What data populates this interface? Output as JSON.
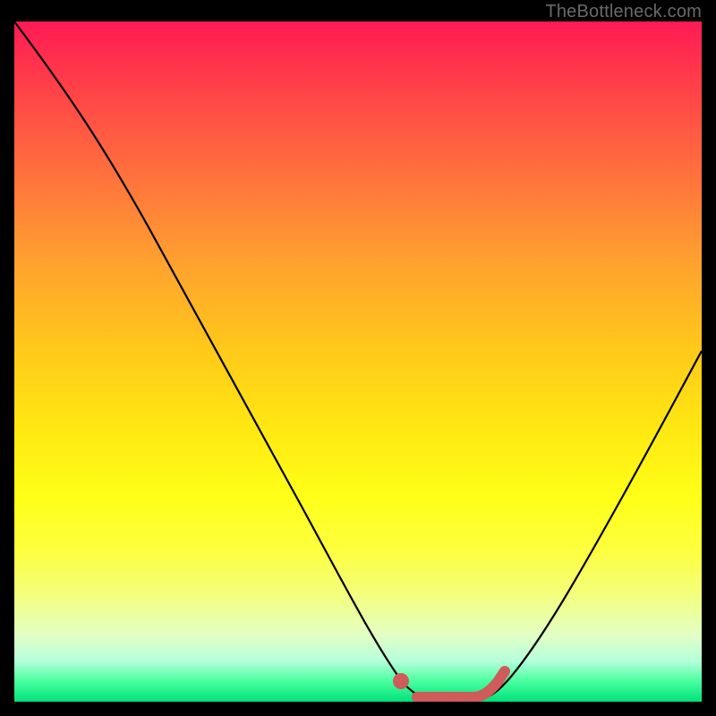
{
  "watermark": "TheBottleneck.com",
  "colors": {
    "background": "#000000",
    "curve": "#000000",
    "highlight": "#cf5b5b",
    "gradient_top": "#ff1a55",
    "gradient_bottom": "#00e27a"
  },
  "chart_data": {
    "type": "line",
    "title": "",
    "xlabel": "",
    "ylabel": "",
    "xlim": [
      0,
      100
    ],
    "ylim": [
      0,
      100
    ],
    "grid": false,
    "series": [
      {
        "name": "bottleneck-curve",
        "x": [
          0,
          4,
          10,
          18,
          26,
          34,
          42,
          50,
          55,
          58,
          60,
          63,
          66,
          70,
          74,
          80,
          86,
          92,
          100
        ],
        "y": [
          100,
          94,
          84,
          70,
          56,
          42,
          28,
          14,
          5,
          1,
          0,
          0,
          0,
          0,
          1,
          6,
          14,
          25,
          45
        ]
      }
    ],
    "annotations": [
      {
        "name": "highlight-segment",
        "type": "segment",
        "x": [
          55,
          58,
          60,
          63,
          66,
          70
        ],
        "y": [
          2,
          0.5,
          0,
          0,
          0,
          1.5
        ]
      }
    ]
  }
}
